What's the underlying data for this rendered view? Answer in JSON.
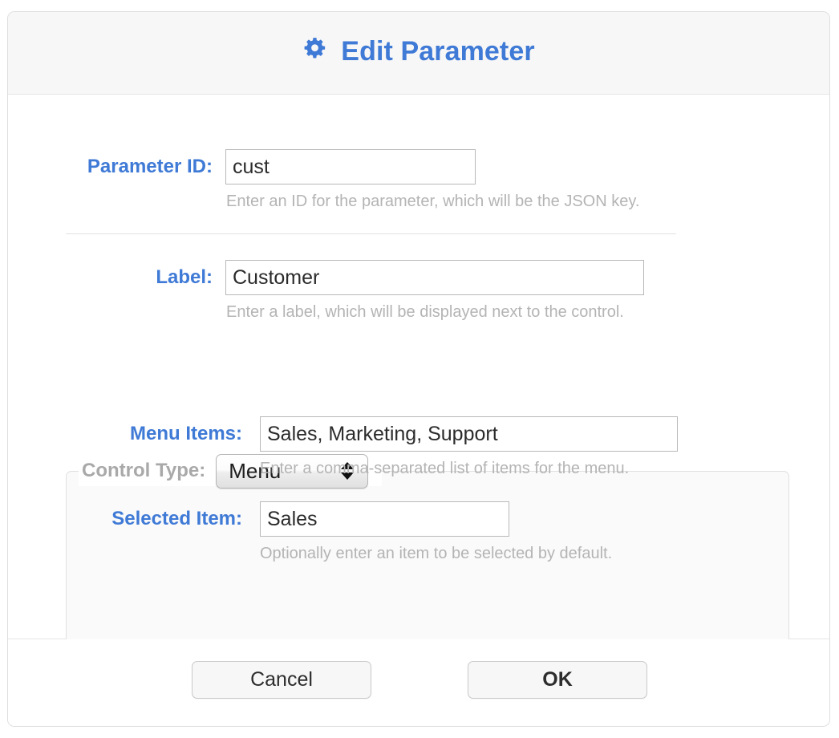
{
  "dialog": {
    "title": "Edit Parameter",
    "title_icon": "gear-icon",
    "accent_color": "#3f7ad6",
    "help_text_color": "#b4b4b4"
  },
  "fields": {
    "parameter_id": {
      "label": "Parameter ID:",
      "value": "cust",
      "help": "Enter an ID for the parameter, which will be the JSON key."
    },
    "label": {
      "label": "Label:",
      "value": "Customer",
      "help": "Enter a label, which will be displayed next to the control."
    }
  },
  "control_type": {
    "legend_label": "Control Type:",
    "selected": "Menu",
    "stepper_icon": "up-down-arrows-icon",
    "menu_items": {
      "label": "Menu Items:",
      "value": "Sales, Marketing, Support",
      "help": "Enter a comma-separated list of items for the menu."
    },
    "selected_item": {
      "label": "Selected Item:",
      "value": "Sales",
      "help": "Optionally enter an item to be selected by default."
    }
  },
  "footer": {
    "cancel_label": "Cancel",
    "ok_label": "OK"
  }
}
